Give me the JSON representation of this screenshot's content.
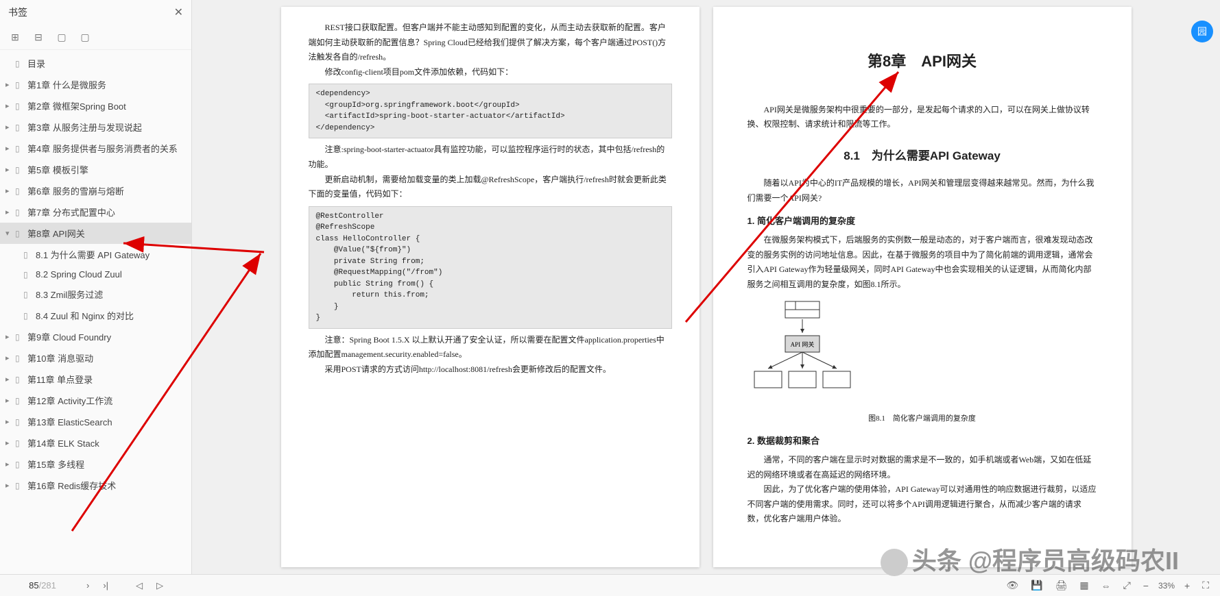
{
  "sidebar": {
    "title": "书签",
    "items": [
      {
        "label": "目录",
        "arrow": false
      },
      {
        "label": "第1章 什么是微服务",
        "arrow": true
      },
      {
        "label": "第2章 微框架Spring Boot",
        "arrow": true
      },
      {
        "label": "第3章 从服务注册与发现说起",
        "arrow": true
      },
      {
        "label": "第4章 服务提供者与服务消费者的关系",
        "arrow": true
      },
      {
        "label": "第5章 模板引擎",
        "arrow": true
      },
      {
        "label": "第6章 服务的雪崩与熔断",
        "arrow": true
      },
      {
        "label": "第7章 分布式配置中心",
        "arrow": true
      },
      {
        "label": "第8章 API网关",
        "arrow": true,
        "expanded": true,
        "active": true,
        "children": [
          {
            "label": "8.1 为什么需要 API Gateway"
          },
          {
            "label": "8.2 Spring Cloud Zuul"
          },
          {
            "label": "8.3 Zmil服务过滤"
          },
          {
            "label": "8.4 Zuul 和 Nginx 的对比"
          }
        ]
      },
      {
        "label": "第9章 Cloud Foundry",
        "arrow": true
      },
      {
        "label": "第10章 消息驱动",
        "arrow": true
      },
      {
        "label": "第11章 单点登录",
        "arrow": true
      },
      {
        "label": "第12章 Activity工作流",
        "arrow": true
      },
      {
        "label": "第13章 ElasticSearch",
        "arrow": true
      },
      {
        "label": "第14章 ELK Stack",
        "arrow": true
      },
      {
        "label": "第15章 多线程",
        "arrow": true
      },
      {
        "label": "第16章 Redis缓存技术",
        "arrow": true
      }
    ]
  },
  "leftPage": {
    "p1": "REST接口获取配置。但客户端并不能主动感知到配置的变化，从而主动去获取新的配置。客户端如何主动获取新的配置信息？Spring Cloud已经给我们提供了解决方案，每个客户端通过POST()方法触发各自的/refresh。",
    "p2": "修改config-client项目pom文件添加依赖，代码如下：",
    "code1": "<dependency>\n  <groupId>org.springframework.boot</groupId>\n  <artifactId>spring-boot-starter-actuator</artifactId>\n</dependency>",
    "p3": "注意:spring-boot-starter-actuator具有监控功能，可以监控程序运行时的状态，其中包括/refresh的功能。",
    "p4": "更新启动机制，需要给加载变量的类上加载@RefreshScope，客户端执行/refresh时就会更新此类下面的变量值，代码如下：",
    "code2": "@RestController\n@RefreshScope\nclass HelloController {\n    @Value(\"${from}\")\n    private String from;\n    @RequestMapping(\"/from\")\n    public String from() {\n        return this.from;\n    }\n}",
    "p5": "注意：Spring Boot 1.5.X 以上默认开通了安全认证，所以需要在配置文件application.properties中添加配置management.security.enabled=false。",
    "p6": "采用POST请求的方式访问http://localhost:8081/refresh会更新修改后的配置文件。"
  },
  "rightPage": {
    "chapterTitle": "第8章　API网关",
    "intro": "API网关是微服务架构中很重要的一部分，是发起每个请求的入口，可以在网关上做协议转换、权限控制、请求统计和限流等工作。",
    "sec1Title": "8.1　为什么需要API Gateway",
    "sec1p1": "随着以API为中心的IT产品规模的增长，API网关和管理层变得越来越常见。然而，为什么我们需要一个API网关?",
    "sub1": "1. 简化客户端调用的复杂度",
    "sub1p1": "在微服务架构模式下，后端服务的实例数一般是动态的，对于客户端而言，很难发现动态改变的服务实例的访问地址信息。因此，在基于微服务的项目中为了简化前端的调用逻辑，通常会引入API Gateway作为轻量级网关，同时API Gateway中也会实现相关的认证逻辑，从而简化内部服务之间相互调用的复杂度，如图8.1所示。",
    "diagramLabel": "API 网关",
    "diagramCaption": "图8.1　简化客户端调用的复杂度",
    "sub2": "2. 数据裁剪和聚合",
    "sub2p1": "通常，不同的客户端在显示时对数据的需求是不一致的，如手机端或者Web端，又如在低延迟的网络环境或者在高延迟的网络环境。",
    "sub2p2": "因此，为了优化客户端的使用体验，API Gateway可以对通用性的响应数据进行裁剪，以适应不同客户端的使用需求。同时，还可以将多个API调用逻辑进行聚合，从而减少客户端的请求数，优化客户端用户体验。"
  },
  "pageNav": {
    "current": "85",
    "total": "/281"
  },
  "zoom": {
    "level": "33%"
  },
  "watermark": "头条 @程序员高级码农II",
  "floatBtn": "园"
}
